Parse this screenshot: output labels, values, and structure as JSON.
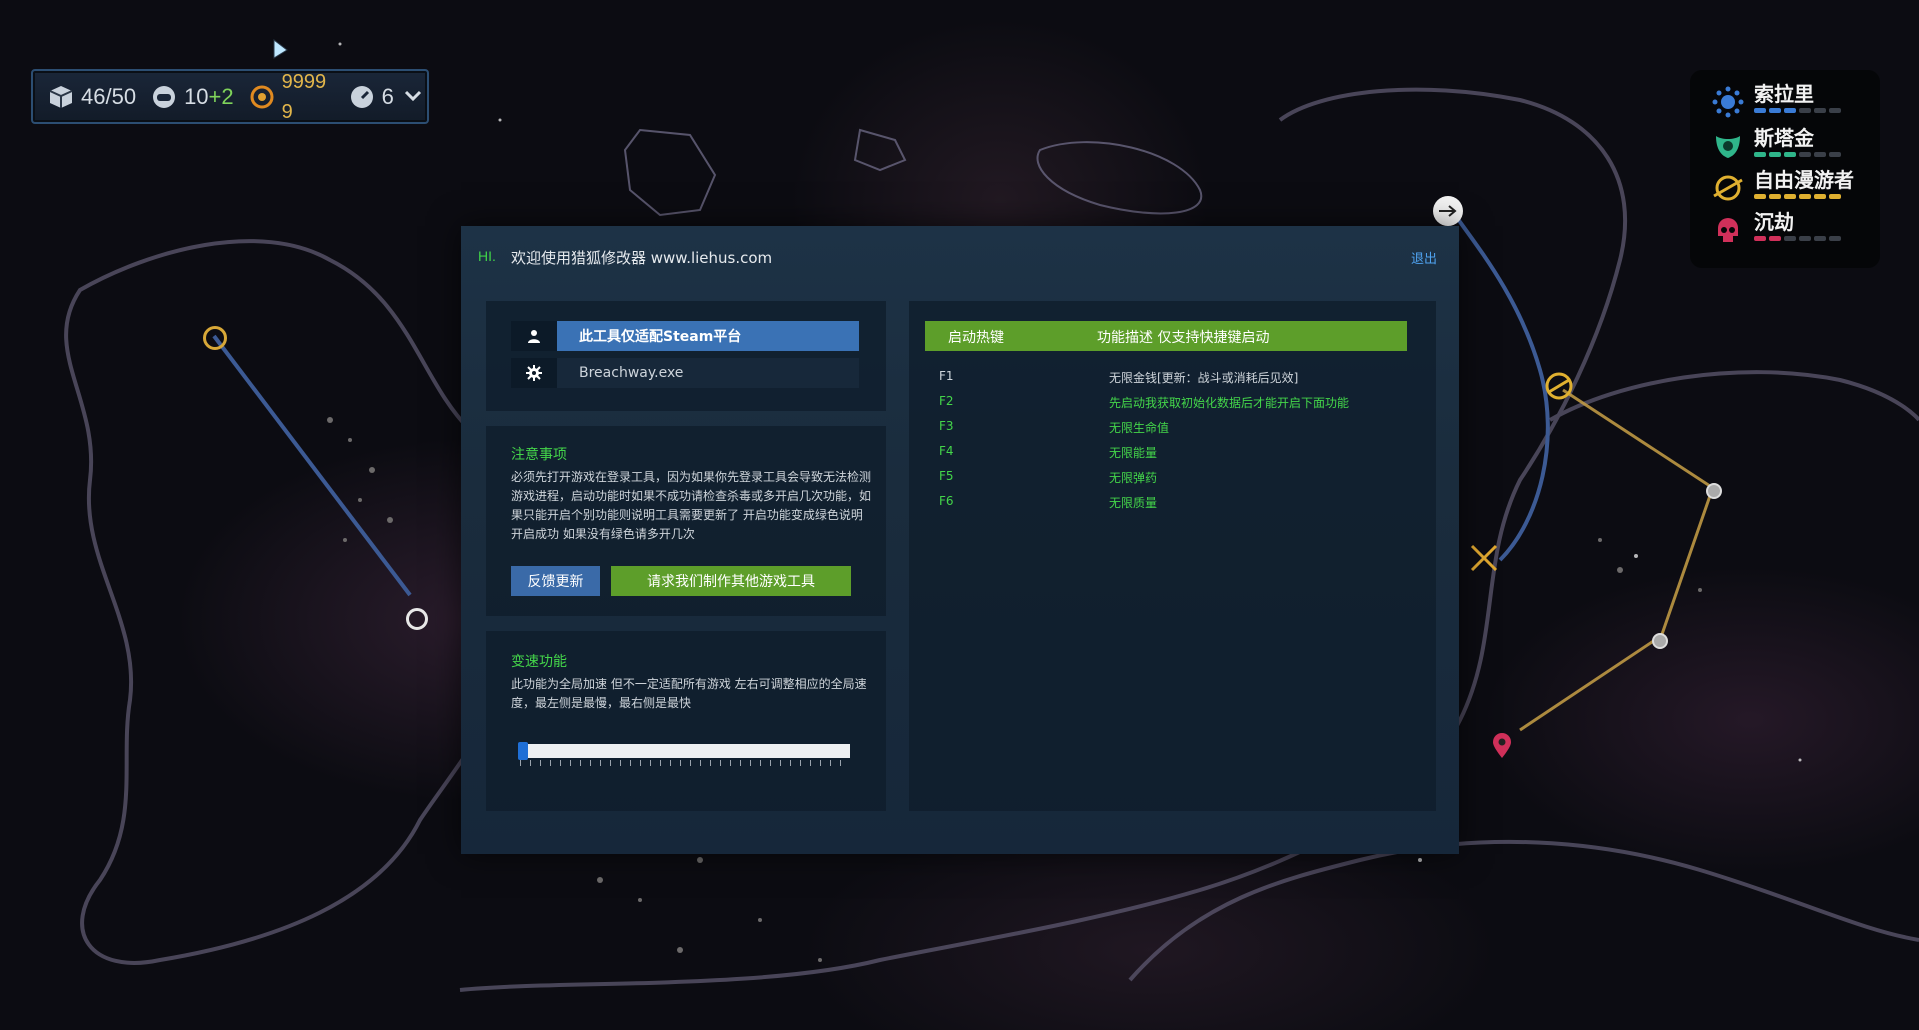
{
  "resources": {
    "cargo": "46/50",
    "crew_base": "10",
    "crew_bonus": "+2",
    "credits": "99999",
    "fuel": "6"
  },
  "factions": [
    {
      "name": "索拉里",
      "color": "#3a7bd5"
    },
    {
      "name": "斯塔金",
      "color": "#2fb58a"
    },
    {
      "name": "自由漫游者",
      "color": "#e0b030"
    },
    {
      "name": "沉劫",
      "color": "#d0305a"
    }
  ],
  "trainer": {
    "hi": "HI.",
    "welcome": "欢迎使用猎狐修改器 www.liehus.com",
    "logout": "退出",
    "platform": "此工具仅适配Steam平台",
    "process": "Breachway.exe",
    "notes_title": "注意事项",
    "notes_text": "必须先打开游戏在登录工具，因为如果你先登录工具会导致无法检测游戏进程，启动功能时如果不成功请检查杀毒或多开启几次功能，如果只能开启个别功能则说明工具需要更新了 开启功能变成绿色说明开启成功 如果没有绿色请多开几次",
    "feedback_btn": "反馈更新",
    "request_btn": "请求我们制作其他游戏工具",
    "speed_title": "变速功能",
    "speed_text": "此功能为全局加速 但不一定适配所有游戏 左右可调整相应的全局速度，最左侧是最慢，最右侧是最快",
    "speed_level": 0,
    "keys_header_key": "启动热键",
    "keys_header_desc": "功能描述 仅支持快捷键启动",
    "hotkeys": [
      {
        "key": "F1",
        "desc": "无限金钱[更新：战斗或消耗后见效]",
        "active": false
      },
      {
        "key": "F2",
        "desc": "先启动我获取初始化数据后才能开启下面功能",
        "active": true
      },
      {
        "key": "F3",
        "desc": "无限生命值",
        "active": true
      },
      {
        "key": "F4",
        "desc": "无限能量",
        "active": true
      },
      {
        "key": "F5",
        "desc": "无限弹药",
        "active": true
      },
      {
        "key": "F6",
        "desc": "无限质量",
        "active": true
      }
    ]
  },
  "colors": {
    "accent_green": "#5d9e2a",
    "accent_blue": "#3a72b5",
    "text_green": "#44d64a"
  }
}
